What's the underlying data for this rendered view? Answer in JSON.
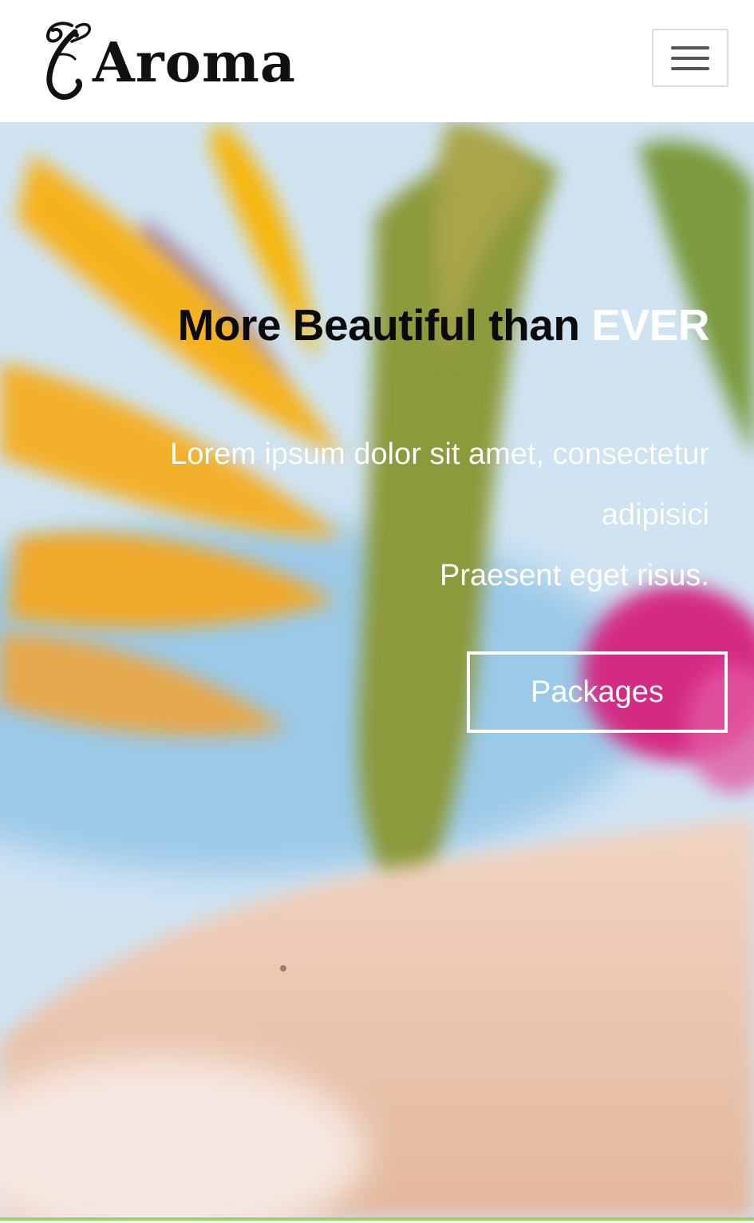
{
  "brand": {
    "name": "Aroma",
    "logo_icon": "calligraphic-e-logo"
  },
  "header": {
    "menu_icon": "hamburger-menu-icon"
  },
  "hero": {
    "title_main": "More Beautiful than ",
    "title_accent": "EVER",
    "subtitle_line1": "Lorem ipsum dolor sit amet, consectetur adipisici",
    "subtitle_line2": "Praesent eget risus.",
    "button_label": "Packages"
  },
  "colors": {
    "accent": "#ffffff",
    "title": "#0b0b0b",
    "bottom_rule": "#9bd36a"
  }
}
